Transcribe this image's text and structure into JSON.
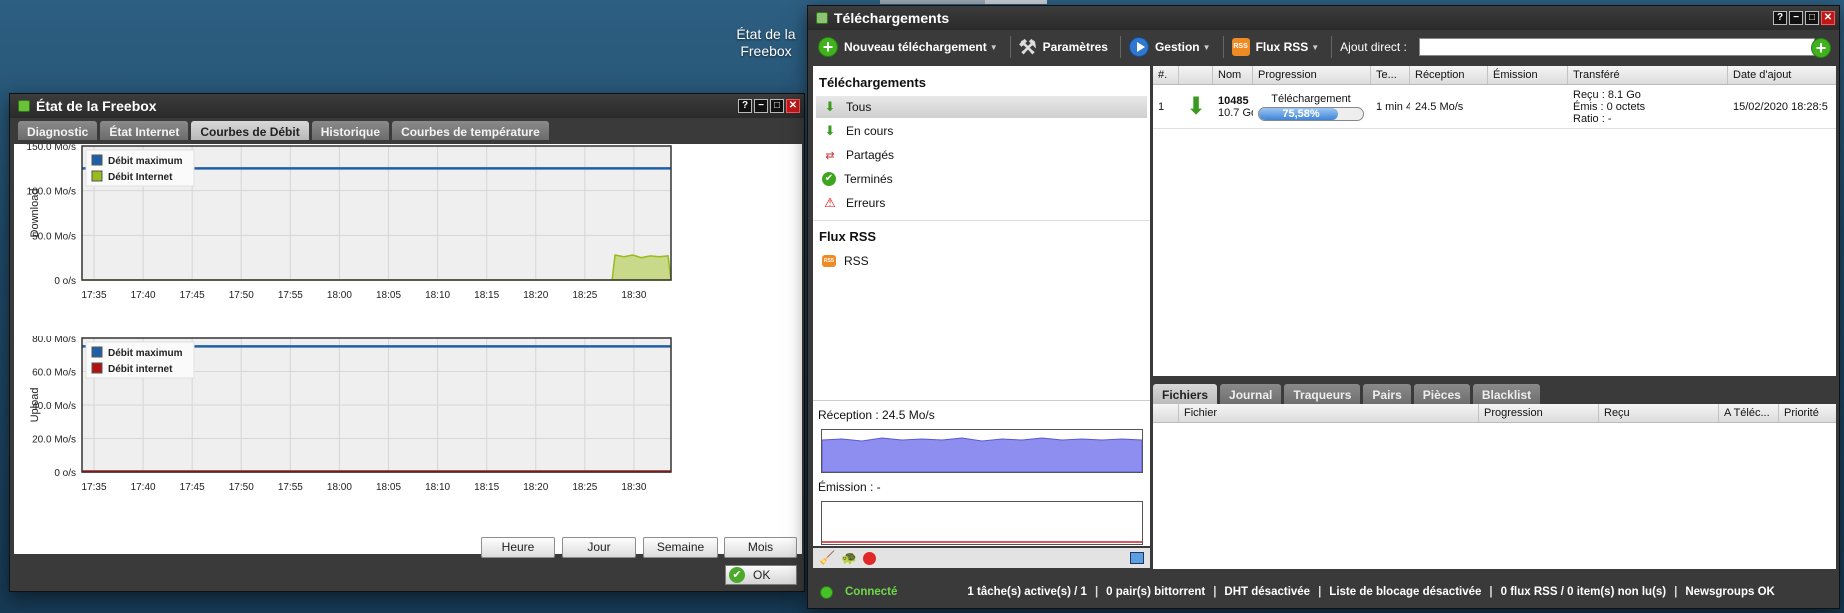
{
  "desktop": {
    "icon_label_1": "État de la",
    "icon_label_2": "Freebox"
  },
  "status_window": {
    "title": "État de la Freebox",
    "tabs": [
      "Diagnostic",
      "État Internet",
      "Courbes de Débit",
      "Historique",
      "Courbes de température"
    ],
    "active_tab": 2,
    "range_buttons": [
      "Heure",
      "Jour",
      "Semaine",
      "Mois"
    ],
    "ok_label": "OK"
  },
  "chart_data": [
    {
      "type": "area",
      "ylabel": "Download",
      "ylim": [
        0,
        150
      ],
      "y_ticks": [
        "150.0 Mo/s",
        "100.0 Mo/s",
        "50.0 Mo/s",
        "0 o/s"
      ],
      "x_ticks": [
        "17:35",
        "17:40",
        "17:45",
        "17:50",
        "17:55",
        "18:00",
        "18:05",
        "18:10",
        "18:15",
        "18:20",
        "18:25",
        "18:30"
      ],
      "grid": true,
      "legend_position": "top-left",
      "series": [
        {
          "name": "Débit maximum",
          "color": "#1f5fa8",
          "type": "line",
          "constant": 125
        },
        {
          "name": "Débit Internet",
          "color": "#9abb1c",
          "type": "area",
          "points": [
            [
              0,
              0
            ],
            [
              0.9,
              0
            ],
            [
              0.905,
              28
            ],
            [
              0.92,
              26
            ],
            [
              0.935,
              28
            ],
            [
              0.95,
              25
            ],
            [
              0.965,
              27
            ],
            [
              0.98,
              26
            ],
            [
              0.995,
              27
            ]
          ]
        }
      ]
    },
    {
      "type": "line",
      "ylabel": "Upload",
      "ylim": [
        0,
        80
      ],
      "y_ticks": [
        "80.0 Mo/s",
        "60.0 Mo/s",
        "40.0 Mo/s",
        "20.0 Mo/s",
        "0 o/s"
      ],
      "x_ticks": [
        "17:35",
        "17:40",
        "17:45",
        "17:50",
        "17:55",
        "18:00",
        "18:05",
        "18:10",
        "18:15",
        "18:20",
        "18:25",
        "18:30"
      ],
      "grid": true,
      "legend_position": "top-left",
      "series": [
        {
          "name": "Débit maximum",
          "color": "#1f5fa8",
          "type": "line",
          "constant": 75
        },
        {
          "name": "Débit internet",
          "color": "#b31212",
          "type": "line",
          "constant": 0.3
        }
      ]
    }
  ],
  "downloads_window": {
    "title": "Téléchargements",
    "toolbar": {
      "new_download": "Nouveau téléchargement",
      "settings": "Paramètres",
      "manage": "Gestion",
      "rss": "Flux RSS",
      "direct_add": "Ajout direct :"
    },
    "sidebar": {
      "downloads_header": "Téléchargements",
      "items": [
        "Tous",
        "En cours",
        "Partagés",
        "Terminés",
        "Erreurs"
      ],
      "rss_header": "Flux RSS",
      "rss_item": "RSS",
      "reception_label": "Réception : 24.5 Mo/s",
      "emission_label": "Émission : -"
    },
    "columns": [
      "#.",
      "",
      "Nom",
      "Progression",
      "Te...",
      "Réception",
      "Émission",
      "Transféré",
      "Date d'ajout"
    ],
    "rows": [
      {
        "num": "1",
        "name": "10485",
        "size": "10.7 Go",
        "status": "Téléchargement",
        "progress_text": "75,58%",
        "progress": 0.7558,
        "time": "1 min 4",
        "reception": "24.5 Mo/s",
        "emission": "",
        "received": "Reçu : 8.1 Go",
        "emitted": "Émis : 0 octets",
        "ratio": "Ratio : -",
        "date": "15/02/2020 18:28:5"
      }
    ],
    "detail_tabs": [
      "Fichiers",
      "Journal",
      "Traqueurs",
      "Pairs",
      "Pièces",
      "Blacklist"
    ],
    "file_columns": [
      "",
      "Fichier",
      "Progression",
      "Reçu",
      "A Téléc...",
      "Priorité"
    ],
    "statusbar": {
      "connected": "Connecté",
      "tasks": "1 tâche(s) active(s) / 1",
      "peers": "0 pair(s) bittorrent",
      "dht": "DHT désactivée",
      "blocklist": "Liste de blocage désactivée",
      "rss": "0 flux RSS / 0 item(s) non lu(s)",
      "newsgroups": "Newsgroups OK"
    }
  }
}
